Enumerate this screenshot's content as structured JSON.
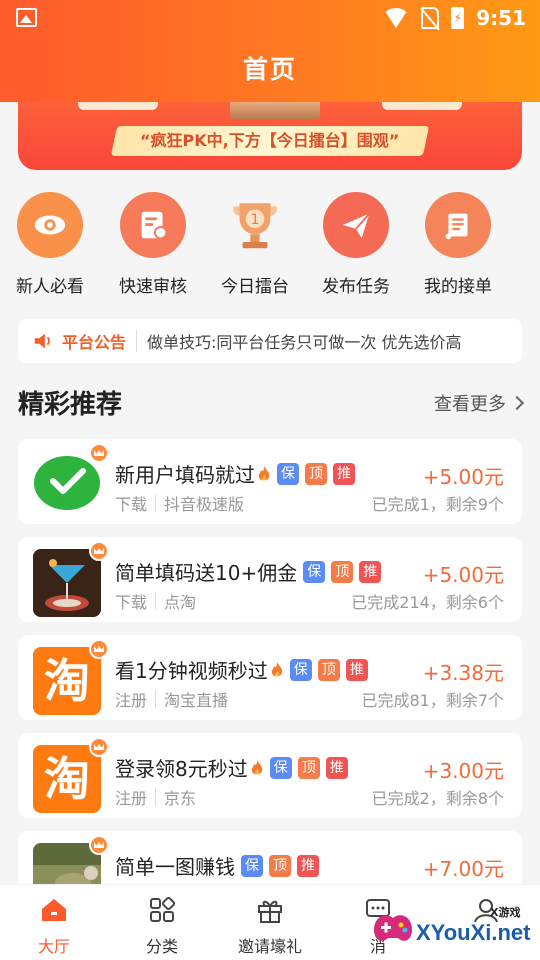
{
  "status_bar": {
    "time": "9:51"
  },
  "header": {
    "title": "首页"
  },
  "banner": {
    "notice": "“疯狂PK中,下方【今日擂台】围观”"
  },
  "quick_menu": [
    {
      "label": "新人必看",
      "icon": "eye-icon",
      "color": "#f9914a"
    },
    {
      "label": "快速审核",
      "icon": "review-doc-icon",
      "color": "#f77a5a"
    },
    {
      "label": "今日擂台",
      "icon": "trophy-icon",
      "color": "#f3a26a"
    },
    {
      "label": "发布任务",
      "icon": "paper-plane-icon",
      "color": "#f46a55"
    },
    {
      "label": "我的接单",
      "icon": "scroll-icon",
      "color": "#f4845a"
    }
  ],
  "notice": {
    "tag": "平台公告",
    "text": "做单技巧:同平台任务只可做一次 优先选价高"
  },
  "section": {
    "title": "精彩推荐",
    "more": "查看更多"
  },
  "tags": {
    "bao": "保",
    "ding": "顶",
    "tui": "推"
  },
  "tasks": [
    {
      "title": "新用户填码就过",
      "hot": true,
      "price": "+5.00元",
      "type": "下载",
      "app": "抖音极速版",
      "stat": "已完成1，剩余9个",
      "thumb": "wechat-check-icon"
    },
    {
      "title": "简单填码送10+佣金",
      "hot": false,
      "price": "+5.00元",
      "type": "下载",
      "app": "点淘",
      "stat": "已完成214，剩余6个",
      "thumb": "cocktail-photo"
    },
    {
      "title": "看1分钟视频秒过",
      "hot": true,
      "price": "+3.38元",
      "type": "注册",
      "app": "淘宝直播",
      "stat": "已完成81，剩余7个",
      "thumb": "taobao-icon",
      "thumb_text": "淘"
    },
    {
      "title": "登录领8元秒过",
      "hot": true,
      "price": "+3.00元",
      "type": "注册",
      "app": "京东",
      "stat": "已完成2，剩余8个",
      "thumb": "taobao-icon",
      "thumb_text": "淘"
    },
    {
      "title": "简单一图赚钱",
      "hot": false,
      "price": "+7.00元",
      "type": "",
      "app": "",
      "stat": "",
      "thumb": "landscape-photo"
    }
  ],
  "bottom_nav": [
    {
      "label": "大厅",
      "icon": "home-icon",
      "active": true
    },
    {
      "label": "分类",
      "icon": "category-grid-icon",
      "active": false
    },
    {
      "label": "邀请壕礼",
      "icon": "gift-icon",
      "active": false
    },
    {
      "label": "消",
      "icon": "message-icon",
      "active": false
    },
    {
      "label": "",
      "icon": "user-icon",
      "active": false
    }
  ],
  "watermark": {
    "small": "X游戏",
    "text": "XYouXi.net"
  },
  "colors": {
    "brand": "#ff6a28",
    "price": "#f26a3a"
  }
}
